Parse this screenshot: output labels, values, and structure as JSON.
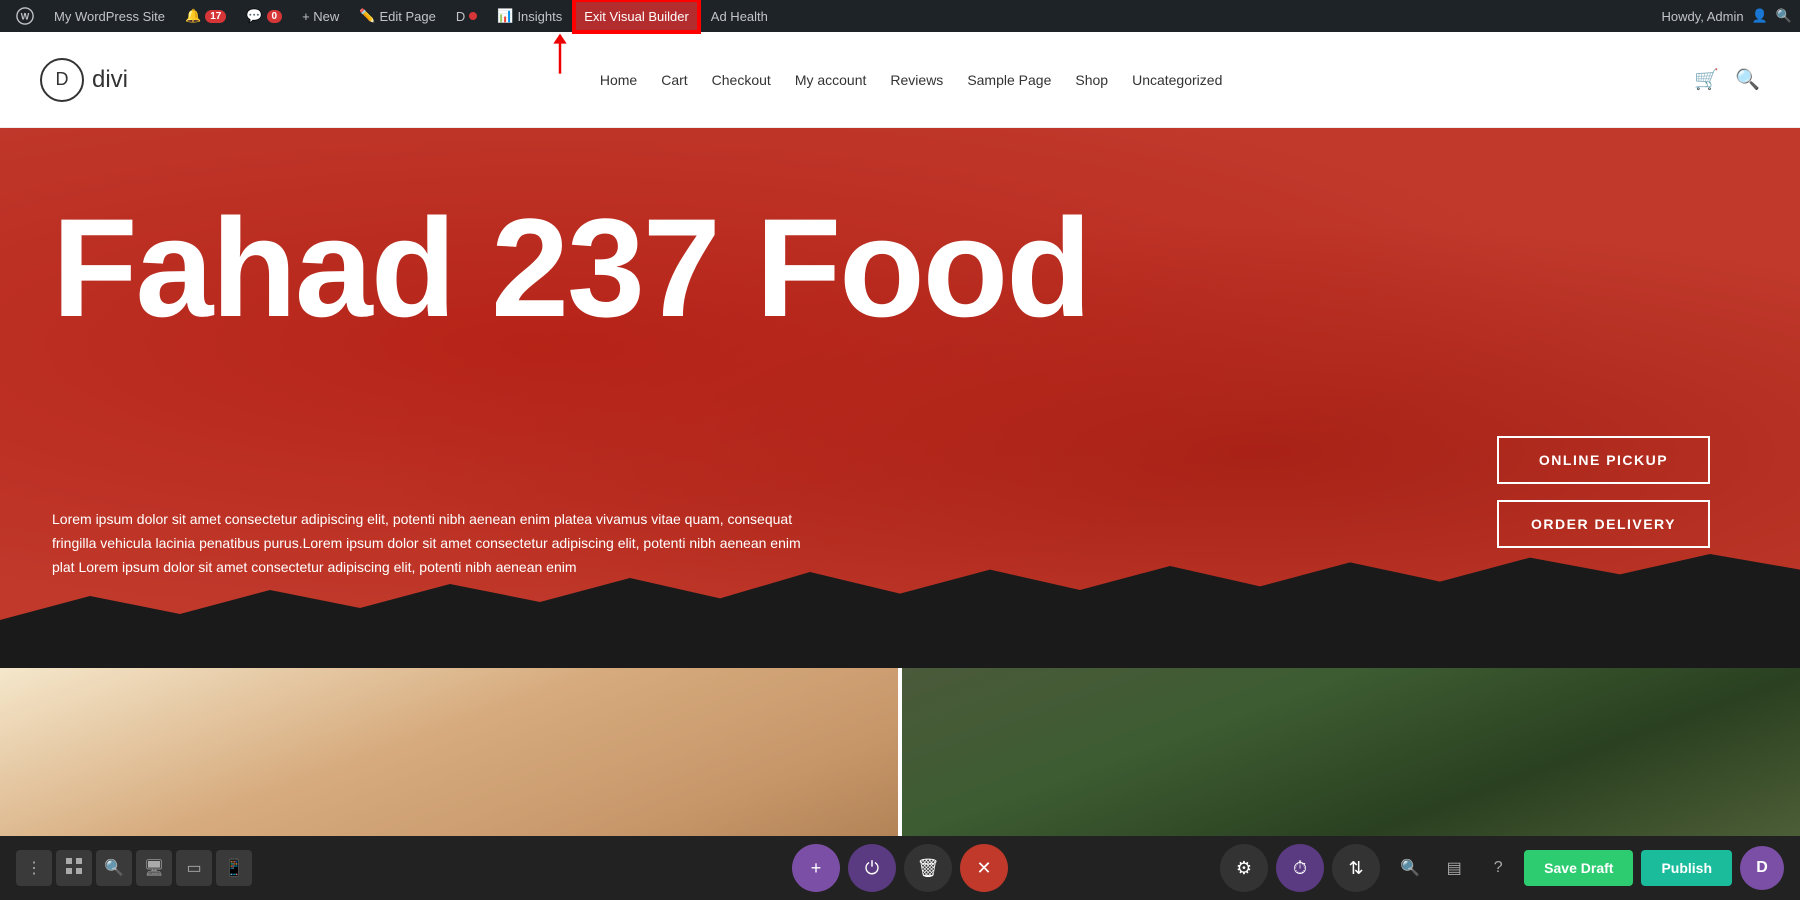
{
  "admin_bar": {
    "wp_icon": "⊞",
    "site_name": "My WordPress Site",
    "updates_count": "17",
    "comments_count": "0",
    "new_label": "+ New",
    "edit_page_label": "Edit Page",
    "divi_icon": "D",
    "insights_label": "Insights",
    "exit_vb_label": "Exit Visual Builder",
    "ad_health_label": "Ad Health",
    "howdy_label": "Howdy, Admin"
  },
  "site_header": {
    "logo_letter": "D",
    "logo_text": "divi",
    "nav_items": [
      "Home",
      "Cart",
      "Checkout",
      "My account",
      "Reviews",
      "Sample Page",
      "Shop",
      "Uncategorized"
    ]
  },
  "hero": {
    "title": "Fahad 237 Food",
    "subtitle": "Lorem ipsum dolor sit amet consectetur adipiscing elit, potenti nibh aenean enim platea vivamus vitae quam, consequat fringilla vehicula lacinia penatibus purus.Lorem ipsum dolor sit amet consectetur adipiscing elit, potenti nibh aenean enim plat Lorem ipsum dolor sit amet consectetur adipiscing elit, potenti nibh aenean enim",
    "btn_pickup": "ONLINE PICKUP",
    "btn_delivery": "ORDER DELIVERY"
  },
  "builder_bar": {
    "save_draft_label": "Save Draft",
    "publish_label": "Publish",
    "icons": {
      "dots": "⋮",
      "grid": "⊞",
      "search": "🔍",
      "desktop": "🖥",
      "tablet": "▭",
      "mobile": "📱",
      "plus": "+",
      "power": "⏻",
      "trash": "🗑",
      "close": "✕",
      "settings": "⚙",
      "history": "⏱",
      "move": "⇅",
      "zoom": "🔍",
      "layers": "▤",
      "help": "?"
    }
  }
}
